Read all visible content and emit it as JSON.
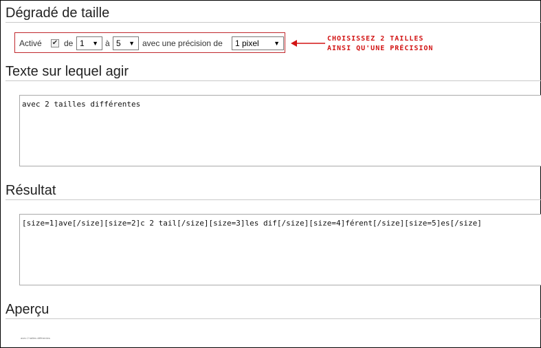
{
  "sections": {
    "gradient": "Dégradé de taille",
    "input": "Texte sur lequel agir",
    "result": "Résultat",
    "preview": "Aperçu"
  },
  "options": {
    "active_label": "Activé",
    "active_checked": true,
    "from_label": "de",
    "from_value": "1",
    "to_label": "à",
    "to_value": "5",
    "precision_label": "avec une précision de",
    "precision_value": "1 pixel"
  },
  "annotation": {
    "line1": "CHOISISSEZ 2 TAILLES",
    "line2": "AINSI QU'UNE PRÉCISION",
    "color": "#d21414"
  },
  "input_text": "avec 2 tailles différentes",
  "result_text": "[size=1]ave[/size][size=2]c 2 tail[/size][size=3]les dif[/size][size=4]férent[/size][size=5]es[/size]",
  "preview_text": "avec 2 tailles différentes"
}
